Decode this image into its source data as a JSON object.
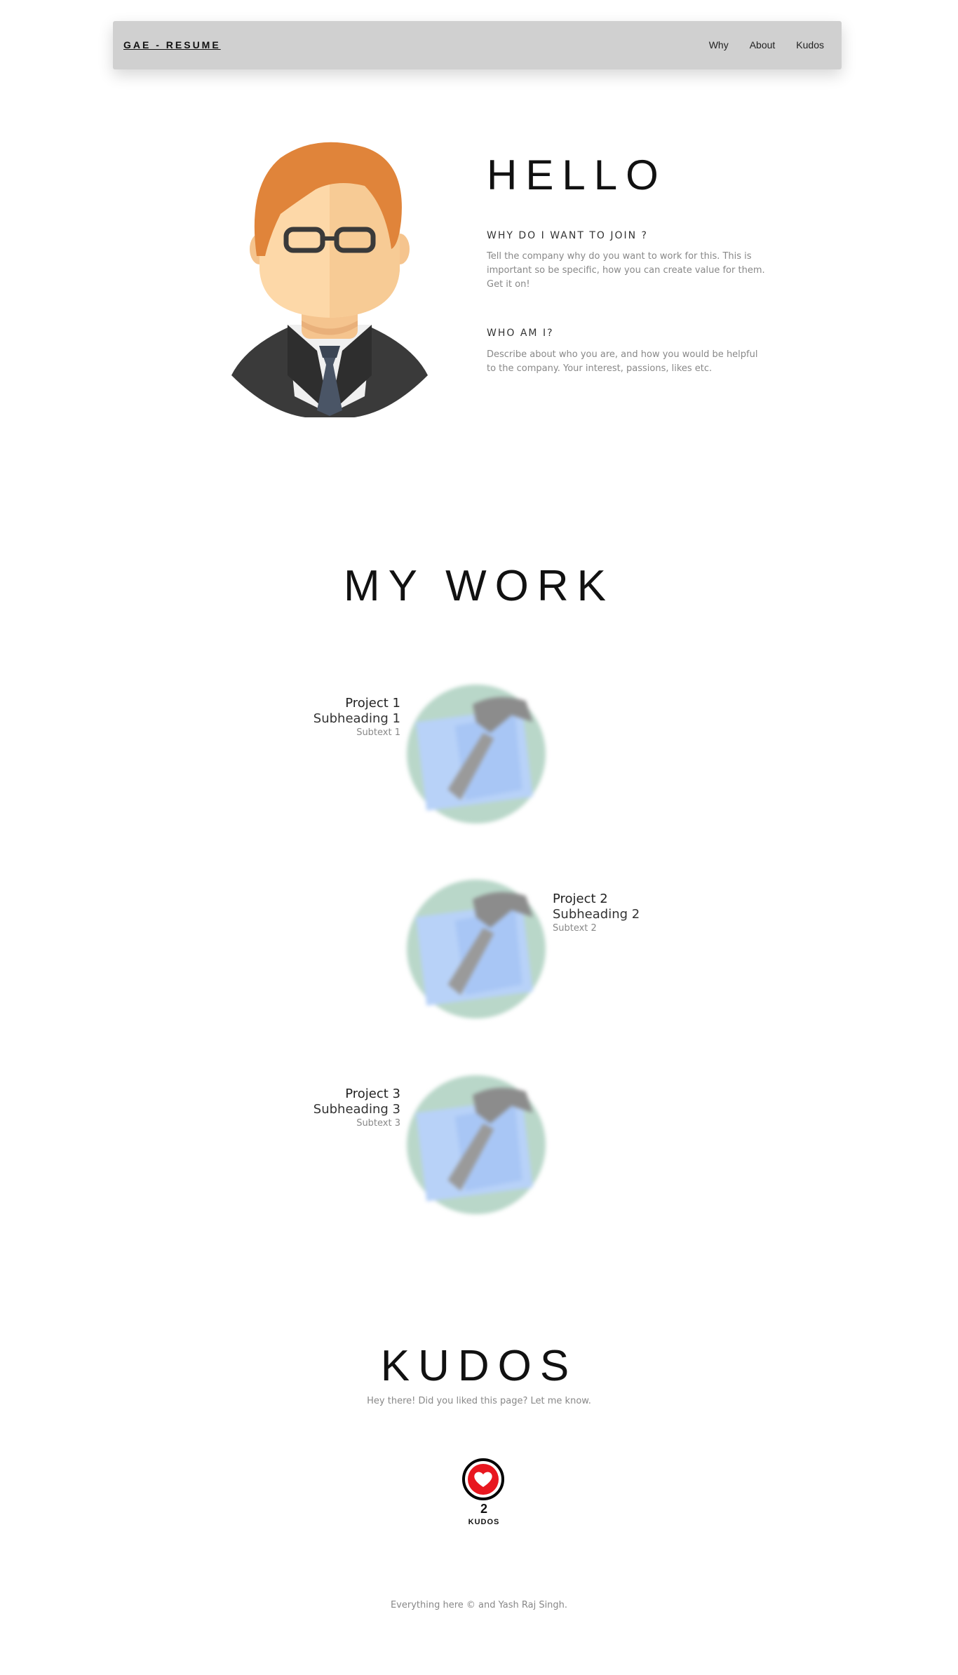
{
  "navbar": {
    "brand": "GAE - RESUME",
    "links": [
      "Why",
      "About",
      "Kudos"
    ]
  },
  "hello": {
    "title": "HELLO",
    "why_heading": "WHY DO I WANT TO JOIN ?",
    "why_text": "Tell the company why do you want to work for this. This is important so be specific, how you can create value for them. Get it on!",
    "who_heading": "WHO AM I?",
    "who_text": "Describe about who you are, and how you would be helpful to the company. Your interest, passions, likes etc."
  },
  "work": {
    "title": "MY WORK",
    "projects": [
      {
        "title": "Project 1",
        "subheading": "Subheading 1",
        "subtext": "Subtext 1"
      },
      {
        "title": "Project 2",
        "subheading": "Subheading 2",
        "subtext": "Subtext 2"
      },
      {
        "title": "Project 3",
        "subheading": "Subheading 3",
        "subtext": "Subtext 3"
      }
    ]
  },
  "kudos": {
    "title": "KUDOS",
    "subtitle": "Hey there! Did you liked this page? Let me know.",
    "count": "2",
    "label": "KUDOS"
  },
  "footer": {
    "text": "Everything here © and Yash Raj Singh."
  },
  "colors": {
    "navbar_bg": "#d0d0d0",
    "kudos_red": "#e8171f",
    "hair": "#e0843a",
    "skin": "#fdd8a8",
    "suit": "#3a3a3a",
    "tie": "#4a5566"
  }
}
